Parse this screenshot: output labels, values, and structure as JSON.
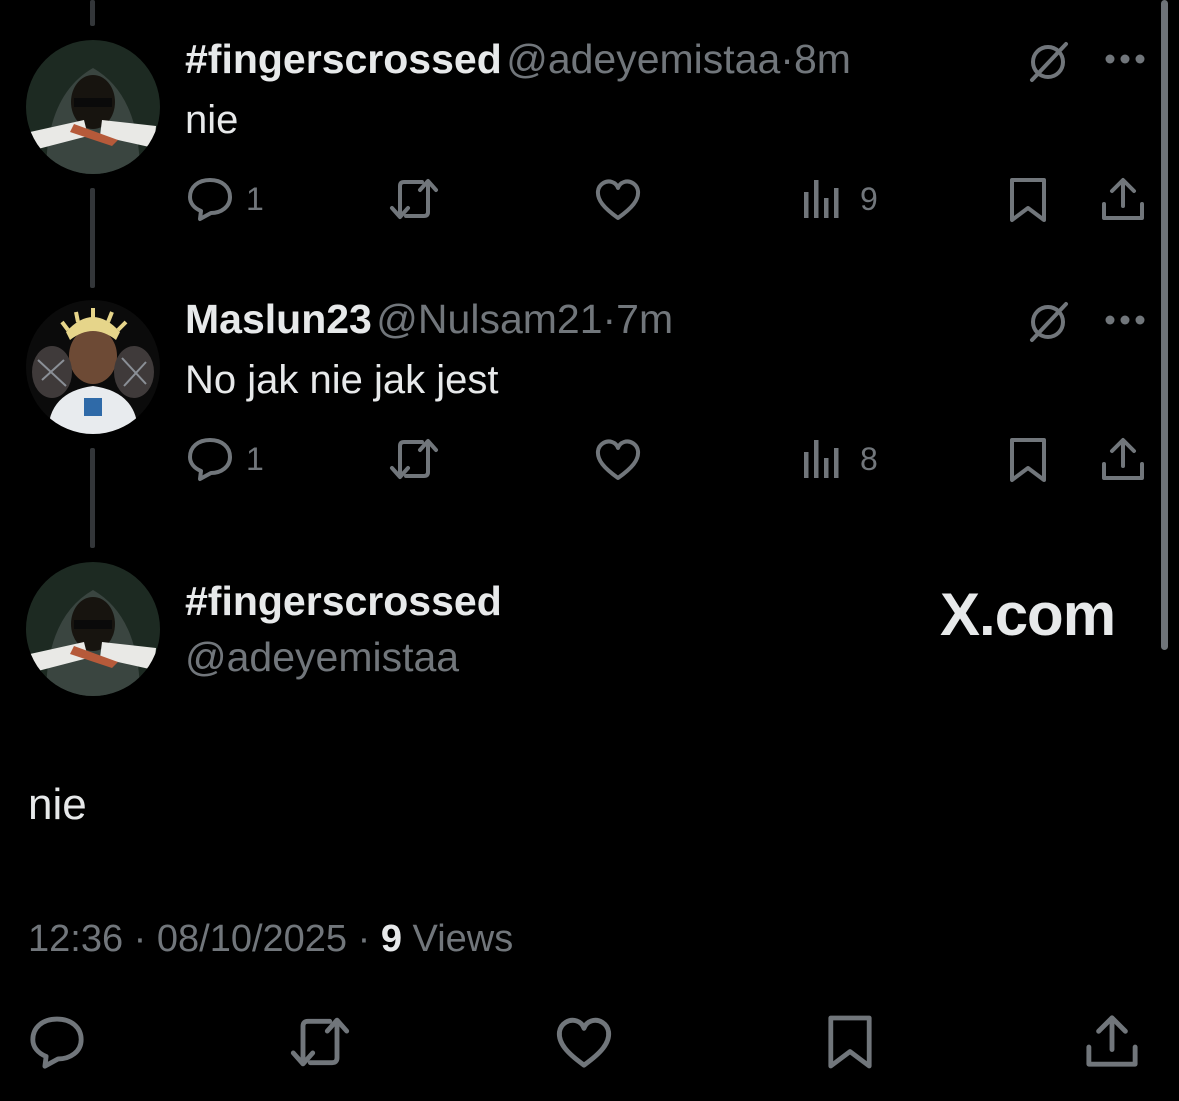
{
  "tweets": [
    {
      "name": "#fingerscrossed",
      "handle": "@adeyemistaa",
      "sep": "·",
      "time": "8m",
      "text": "nie",
      "reply_count": "1",
      "views_count": "9"
    },
    {
      "name": "Maslun23",
      "handle": "@Nulsam21",
      "sep": "·",
      "time": "7m",
      "text": "No jak nie jak jest",
      "reply_count": "1",
      "views_count": "8"
    }
  ],
  "main_tweet": {
    "name": "#fingerscrossed",
    "handle": "@adeyemistaa",
    "brand": "X.com",
    "text": "nie",
    "time": "12:36",
    "date": "08/10/2025",
    "sep": "·",
    "views_number": "9",
    "views_label": "Views"
  },
  "icons": {
    "reply": "reply-icon",
    "retweet": "retweet-icon",
    "like": "heart-icon",
    "views": "views-icon",
    "bookmark": "bookmark-icon",
    "share": "share-icon",
    "grok": "grok-icon",
    "more": "more-icon"
  },
  "colors": {
    "background": "#000000",
    "text": "#e7e9ea",
    "muted": "#71767b",
    "thread_line": "#333639"
  }
}
